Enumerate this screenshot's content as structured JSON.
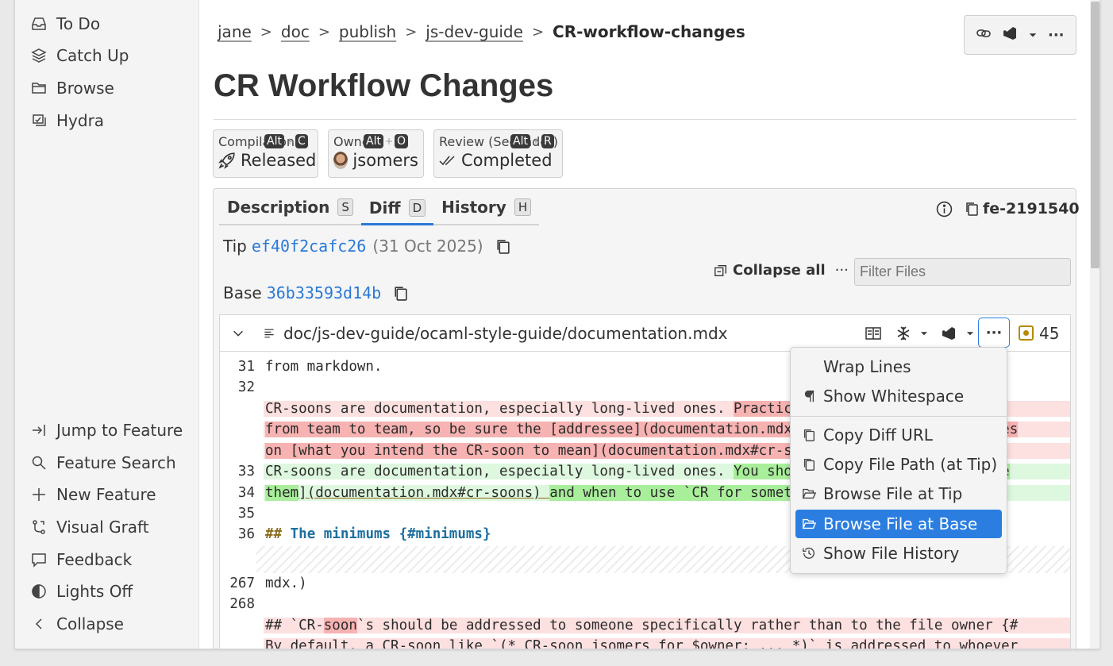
{
  "sidebar": {
    "top_items": [
      {
        "label": "To Do",
        "icon": "inbox-icon"
      },
      {
        "label": "Catch Up",
        "icon": "layers-icon"
      },
      {
        "label": "Browse",
        "icon": "folder-icon"
      },
      {
        "label": "Hydra",
        "icon": "hydra-icon"
      }
    ],
    "bottom_items": [
      {
        "label": "Jump to Feature",
        "icon": "jump-icon"
      },
      {
        "label": "Feature Search",
        "icon": "search-icon"
      },
      {
        "label": "New Feature",
        "icon": "plus-icon"
      },
      {
        "label": "Visual Graft",
        "icon": "graft-icon"
      },
      {
        "label": "Feedback",
        "icon": "feedback-icon"
      },
      {
        "label": "Lights Off",
        "icon": "contrast-icon"
      },
      {
        "label": "Collapse",
        "icon": "chevron-left-icon"
      }
    ]
  },
  "breadcrumb": {
    "items": [
      "jane",
      "doc",
      "publish",
      "js-dev-guide"
    ],
    "separator": ">",
    "current": "CR-workflow-changes"
  },
  "page_title": "CR Workflow Changes",
  "fields": [
    {
      "label": "Compilation",
      "shortcut_mod": "Alt",
      "shortcut_plus": "+",
      "shortcut_key": "C",
      "value": "Released",
      "icon": "rocket-icon"
    },
    {
      "label": "Owner",
      "shortcut_mod": "Alt",
      "shortcut_plus": "+",
      "shortcut_key": "O",
      "value": "jsomers",
      "icon": "avatar"
    },
    {
      "label": "Review (Seconder)",
      "shortcut_mod": "Alt",
      "shortcut_plus": "+",
      "shortcut_key": "R",
      "value": "Completed",
      "icon": "double-check-icon"
    }
  ],
  "tabs": [
    {
      "label": "Description",
      "key": "S",
      "active": false
    },
    {
      "label": "Diff",
      "key": "D",
      "active": true
    },
    {
      "label": "History",
      "key": "H",
      "active": false
    }
  ],
  "feature_id": "fe-2191540",
  "tip": {
    "label": "Tip",
    "hash": "ef40f2cafc26",
    "date": "(31 Oct 2025)"
  },
  "base": {
    "label": "Base",
    "hash": "36b33593d14b"
  },
  "diff_toolbar": {
    "collapse_all": "Collapse all",
    "filter_placeholder": "Filter Files",
    "more": "···"
  },
  "file": {
    "path": "doc/js-dev-guide/ocaml-style-guide/documentation.mdx",
    "comment_count": "45"
  },
  "code_lines": [
    {
      "no": "31",
      "text": "from markdown.",
      "kind": "ctx"
    },
    {
      "no": "32",
      "text": "",
      "kind": "ctx"
    },
    {
      "no": "",
      "text": "CR-soons are documentation, especially long-lived ones. ",
      "mark": "Practices around CR-soons vary",
      "kind": "del"
    },
    {
      "no": "",
      "text": "",
      "mark": "from team to team, so be sure the [addressee](documentation.mdx#cr-soon-addressees) agrees",
      "kind": "del"
    },
    {
      "no": "",
      "text": "",
      "mark": "on [what you intend the CR-soon to mean](documentation.mdx#cr-soons)",
      "kind": "del"
    },
    {
      "no": "33",
      "text": "CR-soons are documentation, especially long-lived ones. ",
      "mark": "You should understand [how to use",
      "kind": "add"
    },
    {
      "no": "34",
      "text": "",
      "mark": "them",
      "text2": "](documentation.mdx#cr-soons) ",
      "mark2": "and when to use `CR for something else`.",
      "kind": "add"
    },
    {
      "no": "35",
      "text": "",
      "kind": "ctx"
    },
    {
      "no": "36",
      "hdr": "##",
      "hdr2": "The minimums {#minimums}",
      "kind": "ctx"
    },
    {
      "no": "267",
      "text": "mdx.)",
      "kind": "ctx"
    },
    {
      "no": "268",
      "text": "",
      "kind": "ctx"
    },
    {
      "no": "",
      "text": "## `CR-",
      "mark": "soon",
      "text2": "`s should be addressed to someone specifically rather than to the file owner {#",
      "kind": "del"
    },
    {
      "no": "",
      "text": "By default, a CR-soon like `(* CR-soon jsomers for $owner: ... *)` is addressed to whoever",
      "kind": "del"
    }
  ],
  "menu": {
    "items": [
      {
        "label": "Wrap Lines",
        "icon": ""
      },
      {
        "label": "Show Whitespace",
        "icon": "pilcrow-icon"
      },
      {
        "label": "Copy Diff URL",
        "icon": "copy-icon"
      },
      {
        "label": "Copy File Path (at Tip)",
        "icon": "copy-icon"
      },
      {
        "label": "Browse File at Tip",
        "icon": "folder-open-icon"
      },
      {
        "label": "Browse File at Base",
        "icon": "folder-open-icon",
        "selected": true
      },
      {
        "label": "Show File History",
        "icon": "history-icon"
      }
    ]
  },
  "colors": {
    "accent": "#2b7ee0",
    "link": "#2a79d6",
    "deleted_bg": "#fde0e0",
    "deleted_mark": "#f7b2b2",
    "added_bg": "#def7df",
    "added_mark": "#a9ee9b",
    "comment_badge": "#b58a00"
  }
}
